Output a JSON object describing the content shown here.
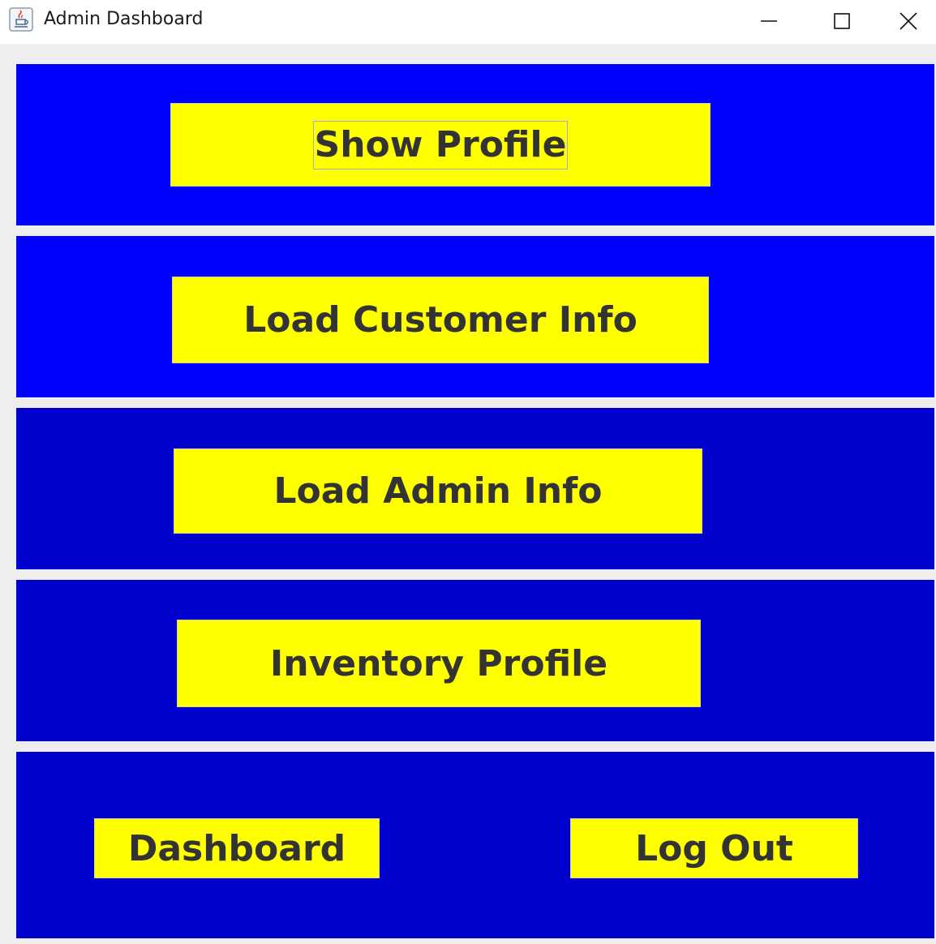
{
  "window": {
    "title": "Admin Dashboard",
    "icon": "java-coffee-cup-icon",
    "controls": [
      "minimize-icon",
      "maximize-icon",
      "close-icon"
    ]
  },
  "buttons": {
    "show_profile": "Show Profile",
    "load_customer_info": "Load Customer Info",
    "load_admin_info": "Load Admin Info",
    "inventory_profile": "Inventory Profile",
    "dashboard": "Dashboard",
    "log_out": "Log Out"
  },
  "colors": {
    "panel_bright_blue": "#0000ff",
    "panel_dark_blue": "#0000cd",
    "button_yellow": "#ffff00",
    "button_text": "#333333",
    "window_background": "#eeeeee"
  }
}
